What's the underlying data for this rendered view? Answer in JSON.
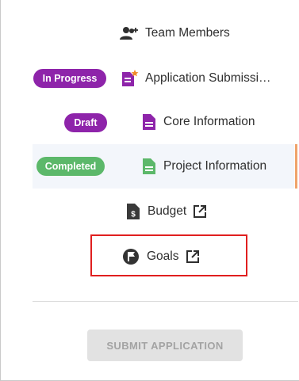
{
  "nav": {
    "items": [
      {
        "label": "Team Members",
        "icon": "team-members-icon"
      },
      {
        "label": "Application Submissi…",
        "status": "In Progress",
        "icon": "application-document-star-icon"
      },
      {
        "label": "Core Information",
        "status": "Draft",
        "icon": "document-icon"
      },
      {
        "label": "Project Information",
        "status": "Completed",
        "icon": "document-icon"
      },
      {
        "label": "Budget",
        "icon": "budget-document-icon",
        "external": true
      },
      {
        "label": "Goals",
        "icon": "flag-circle-icon",
        "external": true
      }
    ]
  },
  "actions": {
    "submit_label": "SUBMIT APPLICATION"
  },
  "colors": {
    "in_progress": "#8e24aa",
    "draft": "#8e24aa",
    "completed": "#5cb86a",
    "highlight_box": "#e01f1f",
    "accent": "#f0a36a",
    "doc_purple": "#8e24aa",
    "doc_green": "#5cb86a"
  }
}
